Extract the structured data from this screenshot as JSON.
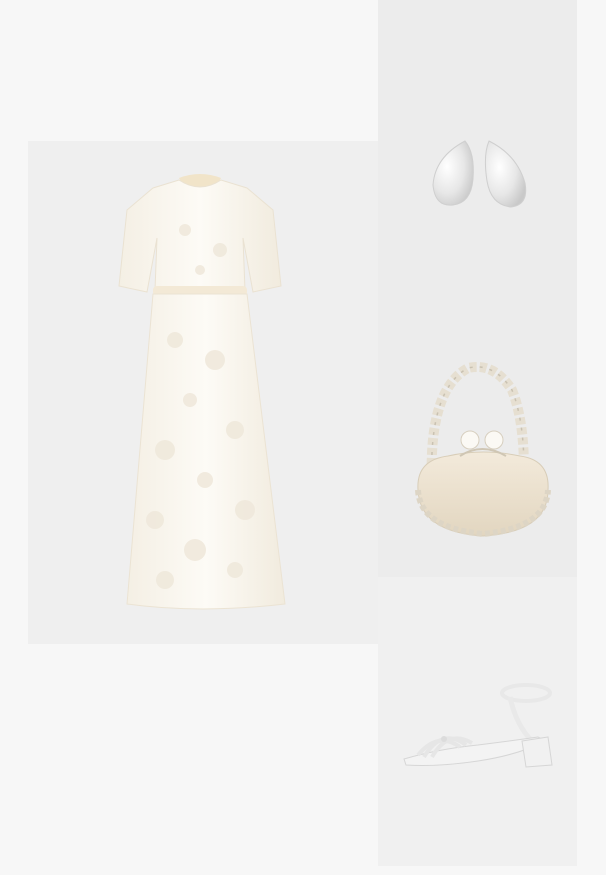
{
  "board": {
    "background": "#f7f7f7",
    "panel_colors": {
      "dress": "#efefef",
      "accessories": "#ececec",
      "shoes": "#f0f0f0"
    }
  },
  "items": [
    {
      "name": "dress",
      "icon": "dress-icon",
      "color": "#fbf8f1"
    },
    {
      "name": "earrings",
      "icon": "earrings-icon",
      "color": "#f6f6f6"
    },
    {
      "name": "handbag",
      "icon": "handbag-icon",
      "color": "#efe7d8"
    },
    {
      "name": "sandal",
      "icon": "sandal-icon",
      "color": "#f2f2f2"
    }
  ]
}
